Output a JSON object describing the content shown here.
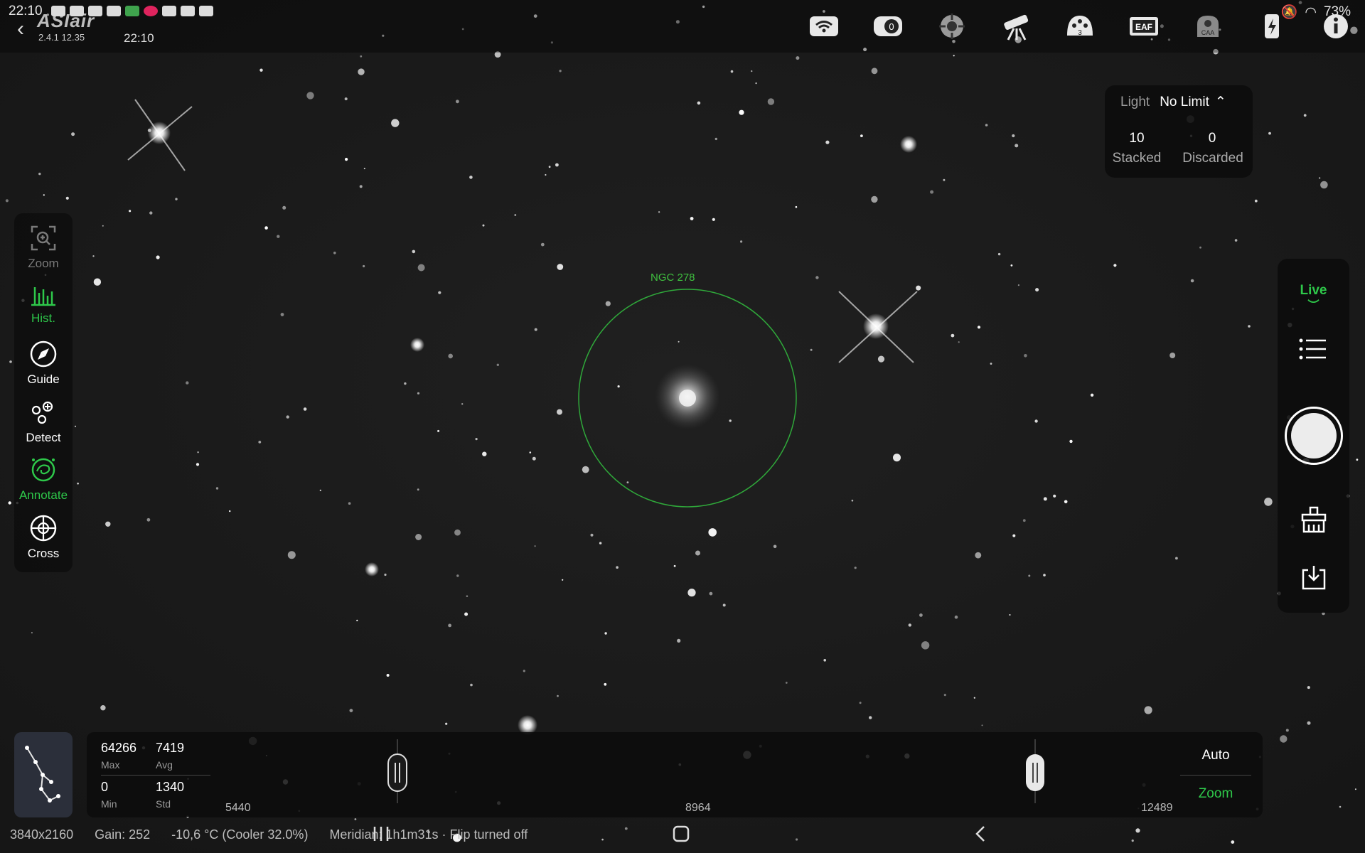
{
  "status_bar": {
    "time": "22:10",
    "battery": "73%"
  },
  "app": {
    "logo": "ASIair",
    "version": "2.4.1 12.35",
    "clock": "22:10"
  },
  "devices": [
    "wifi-icon",
    "camera-icon",
    "guide-scope-icon",
    "telescope-icon",
    "filter-wheel-icon",
    "eaf-icon",
    "caa-icon",
    "power-icon",
    "info-icon"
  ],
  "stack_panel": {
    "frame_type": "Light",
    "limit": "No Limit",
    "stacked_value": "10",
    "stacked_label": "Stacked",
    "discarded_value": "0",
    "discarded_label": "Discarded"
  },
  "tools": [
    {
      "label": "Zoom",
      "state": "disabled"
    },
    {
      "label": "Hist.",
      "state": "active"
    },
    {
      "label": "Guide",
      "state": "normal"
    },
    {
      "label": "Detect",
      "state": "normal"
    },
    {
      "label": "Annotate",
      "state": "active"
    },
    {
      "label": "Cross",
      "state": "normal"
    }
  ],
  "capture": {
    "mode": "Live"
  },
  "annotation": {
    "object": "NGC 278"
  },
  "histogram": {
    "max_value": "64266",
    "max_label": "Max",
    "avg_value": "7419",
    "avg_label": "Avg",
    "min_value": "0",
    "min_label": "Min",
    "std_value": "1340",
    "std_label": "Std",
    "left_value": "5440",
    "mid_value": "8964",
    "right_value": "12489",
    "black_point": 0.19,
    "white_point": 0.88,
    "auto_label": "Auto",
    "zoom_label": "Zoom"
  },
  "info": {
    "resolution": "3840x2160",
    "gain": "Gain: 252",
    "temperature": "-10,6 °C (Cooler 32.0%)",
    "meridian": "Meridian: 1h1m31s · Flip turned off"
  },
  "colors": {
    "accent": "#2ec84a",
    "annotation": "#3fbf3f",
    "background": "#141414"
  }
}
